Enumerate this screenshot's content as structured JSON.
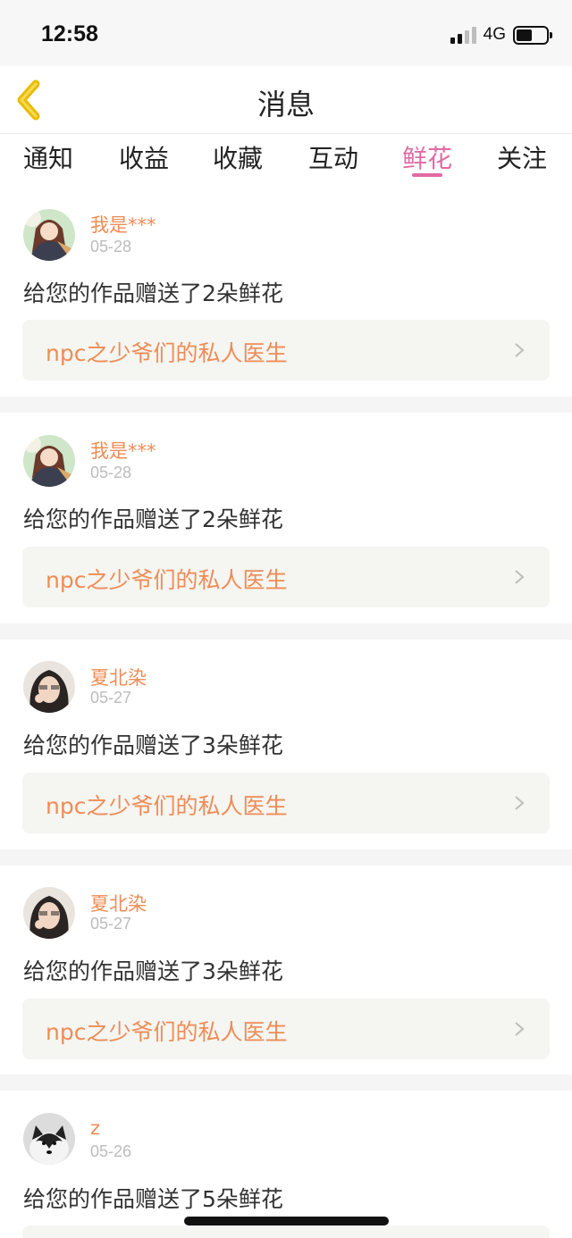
{
  "status_bar": {
    "time": "12:58",
    "network": "4G"
  },
  "header": {
    "title": "消息",
    "back_icon": "chevron-left-icon",
    "accent_color": "#f2c200"
  },
  "tabs": [
    {
      "label": "通知",
      "active": false
    },
    {
      "label": "收益",
      "active": false
    },
    {
      "label": "收藏",
      "active": false
    },
    {
      "label": "互动",
      "active": false
    },
    {
      "label": "鲜花",
      "active": true
    },
    {
      "label": "关注",
      "active": false
    }
  ],
  "messages": [
    {
      "username": "我是***",
      "date": "05-28",
      "text": "给您的作品赠送了2朵鲜花",
      "work_title": "npc之少爷们的私人医生",
      "avatar": "anime-girl-avatar"
    },
    {
      "username": "我是***",
      "date": "05-28",
      "text": "给您的作品赠送了2朵鲜花",
      "work_title": "npc之少爷们的私人医生",
      "avatar": "anime-girl-avatar"
    },
    {
      "username": "夏北染",
      "date": "05-27",
      "text": "给您的作品赠送了3朵鲜花",
      "work_title": "npc之少爷们的私人医生",
      "avatar": "woman-photo-avatar"
    },
    {
      "username": "夏北染",
      "date": "05-27",
      "text": "给您的作品赠送了3朵鲜花",
      "work_title": "npc之少爷们的私人医生",
      "avatar": "woman-photo-avatar"
    },
    {
      "username": "z",
      "date": "05-26",
      "text": "给您的作品赠送了5朵鲜花",
      "work_title": "",
      "avatar": "husky-dog-avatar"
    }
  ],
  "colors": {
    "accent_pink": "#e16aa3",
    "username_orange": "#ef8c56",
    "card_link_bg": "#f5f5f1"
  }
}
